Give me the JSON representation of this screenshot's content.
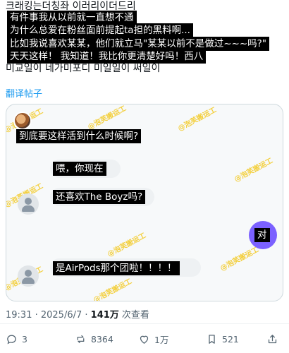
{
  "post": {
    "ghost_top": "크래킹는더칭좌 이러리이더드리",
    "ghost_bottom": "미교일이 네가미포디 미일일이 써일이",
    "captions": [
      "有件事我从以前就一直想不通",
      "为什么总爱在粉丝面前提起ta担的黑料啊...",
      "比如我说喜欢某某，他们就立马\"某某以前不是做过~~~吗?\"",
      "天天这样！ 我知道！我比你更清楚好吗！西八"
    ],
    "translate_label": "翻译帖子"
  },
  "screenshot": {
    "watermark": "@泡芙搬运工",
    "messages": [
      {
        "text": "到底要这样活到什么时候啊?"
      },
      {
        "text": "喂，你现在"
      },
      {
        "text": "还喜欢The Boyz吗?"
      },
      {
        "text": "对"
      },
      {
        "text": "是AirPods那个团啦！！！！"
      }
    ]
  },
  "meta": {
    "time": "19:31 · 2025/6/7 · ",
    "views_count": "141万",
    "views_label": " 次查看"
  },
  "actions": {
    "replies": "3",
    "reposts": "8364",
    "likes": "1万",
    "bookmarks": "521"
  },
  "colors": {
    "accent_blue": "#1d9bf0",
    "chat_purple": "#7b61ff",
    "watermark_yellow": "#f2c200"
  }
}
